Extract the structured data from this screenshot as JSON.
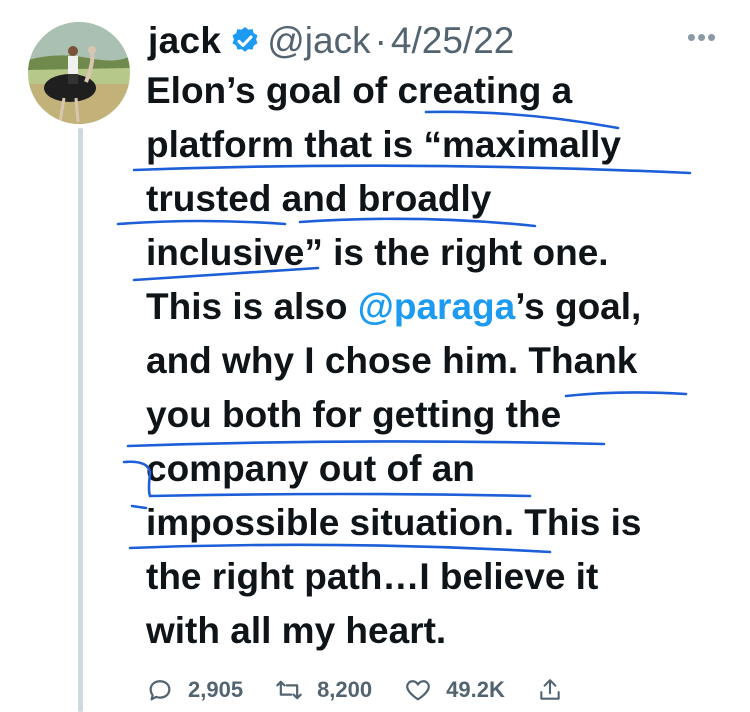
{
  "tweet": {
    "author": {
      "name": "jack",
      "handle": "@jack",
      "verified": true,
      "avatar": "profile photo of a person riding an ostrich"
    },
    "separator": "·",
    "date": "4/25/22",
    "more_icon": "more-horizontal-icon",
    "lines": [
      {
        "text": "Elon’s goal of creating a"
      },
      {
        "text": "platform that is “maximally"
      },
      {
        "text": "trusted and broadly"
      },
      {
        "text": "inclusive” is the right one."
      },
      {
        "before": "This is also ",
        "mention": "@paraga",
        "after": "’s goal,"
      },
      {
        "text": "and why I chose him. Thank"
      },
      {
        "text": "you both for getting the"
      },
      {
        "text": "company out of an"
      },
      {
        "text": "impossible situation. This is"
      },
      {
        "text": "the right path…I believe it"
      },
      {
        "text": "with all my heart."
      }
    ],
    "actions": {
      "replies": "2,905",
      "retweets": "8,200",
      "likes": "49.2K"
    }
  },
  "colors": {
    "text": "#0f1419",
    "secondary": "#536471",
    "link": "#1d9bf0",
    "verified": "#1d9bf0",
    "annotation_ink": "#1d5fd8",
    "thread_line": "#cfd9de"
  }
}
